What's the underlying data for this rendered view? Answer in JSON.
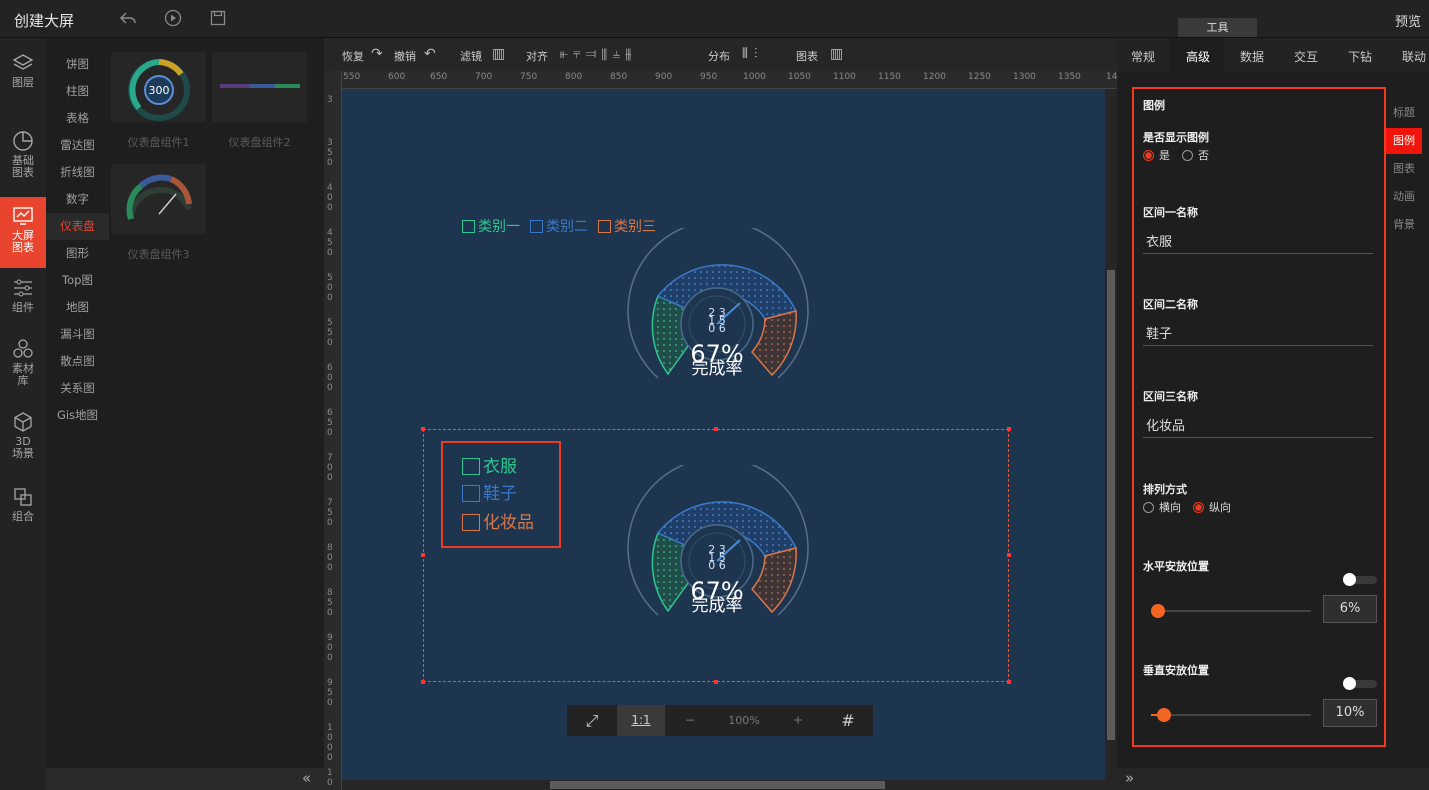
{
  "header": {
    "title": "创建大屏",
    "preview": "预览",
    "tools_tab": "工具"
  },
  "leftnav": [
    {
      "label": "图层",
      "icon": "layers-icon"
    },
    {
      "label": "基础图表",
      "icon": "chart-icon"
    },
    {
      "label": "大屏图表",
      "icon": "screen-chart-icon"
    },
    {
      "label": "组件",
      "icon": "sliders-icon"
    },
    {
      "label": "素材库",
      "icon": "material-icon"
    },
    {
      "label": "3D场景",
      "icon": "cube-icon"
    },
    {
      "label": "组合",
      "icon": "group-icon"
    }
  ],
  "categories": [
    "饼图",
    "柱图",
    "表格",
    "雷达图",
    "折线图",
    "数字",
    "仪表盘",
    "图形",
    "Top图",
    "地图",
    "漏斗图",
    "散点图",
    "关系图",
    "Gis地图"
  ],
  "active_category": "仪表盘",
  "thumbnails": [
    {
      "label": "仪表盘组件1",
      "value": "300"
    },
    {
      "label": "仪表盘组件2"
    },
    {
      "label": "仪表盘组件3"
    }
  ],
  "toolbar": {
    "redo": "恢复",
    "undo": "撤销",
    "filter": "滤镜",
    "align": "对齐",
    "distribute": "分布",
    "chart": "图表"
  },
  "ruler_top": [
    "550",
    "600",
    "650",
    "700",
    "750",
    "800",
    "850",
    "900",
    "950",
    "1000",
    "1050",
    "1100",
    "1150",
    "1200",
    "1250",
    "1300",
    "1350",
    "14"
  ],
  "ruler_left": [
    "3",
    "3 5 0",
    "4 0 0",
    "4 5 0",
    "5 0 0",
    "5 5 0",
    "6 0 0",
    "6 5 0",
    "7 0 0",
    "7 5 0",
    "8 0 0",
    "8 5 0",
    "9 0 0",
    "9 5 0",
    "1 0 0 0",
    "1 0"
  ],
  "gauge_top": {
    "legend": [
      "类别一",
      "类别二",
      "类别三"
    ],
    "center_top": "2 3",
    "center_mid": "1   5",
    "center_bot": "0   6",
    "percent": "67%",
    "caption": "完成率"
  },
  "gauge_bottom": {
    "legend": [
      "衣服",
      "鞋子",
      "化妆品"
    ],
    "center_top": "2 3",
    "center_mid": "1   5",
    "center_bot": "0   6",
    "percent": "67%",
    "caption": "完成率"
  },
  "colors": {
    "green": "#2fc68f",
    "blue": "#3a79c9",
    "orange": "#d9774a",
    "accent": "#ef3a1f"
  },
  "zoom": {
    "fit": "⤢",
    "one_to_one": "1:1",
    "minus": "−",
    "value": "100%",
    "plus": "+",
    "grid": "#"
  },
  "right_tabs": [
    "常规",
    "高级",
    "数据",
    "交互",
    "下钻",
    "联动"
  ],
  "active_right_tab": "高级",
  "side_tabs": [
    "标题",
    "图例",
    "图表",
    "动画",
    "背景"
  ],
  "active_side_tab": "图例",
  "legend_settings": {
    "section_title": "图例",
    "show_label": "是否显示图例",
    "show_yes": "是",
    "show_no": "否",
    "show_value": "是",
    "name1_label": "区间一名称",
    "name1": "衣服",
    "name2_label": "区间二名称",
    "name2": "鞋子",
    "name3_label": "区间三名称",
    "name3": "化妆品",
    "layout_label": "排列方式",
    "layout_h": "横向",
    "layout_v": "纵向",
    "layout_value": "纵向",
    "hpos_label": "水平安放位置",
    "hpos_value": "6%",
    "vpos_label": "垂直安放位置",
    "vpos_value": "10%"
  }
}
